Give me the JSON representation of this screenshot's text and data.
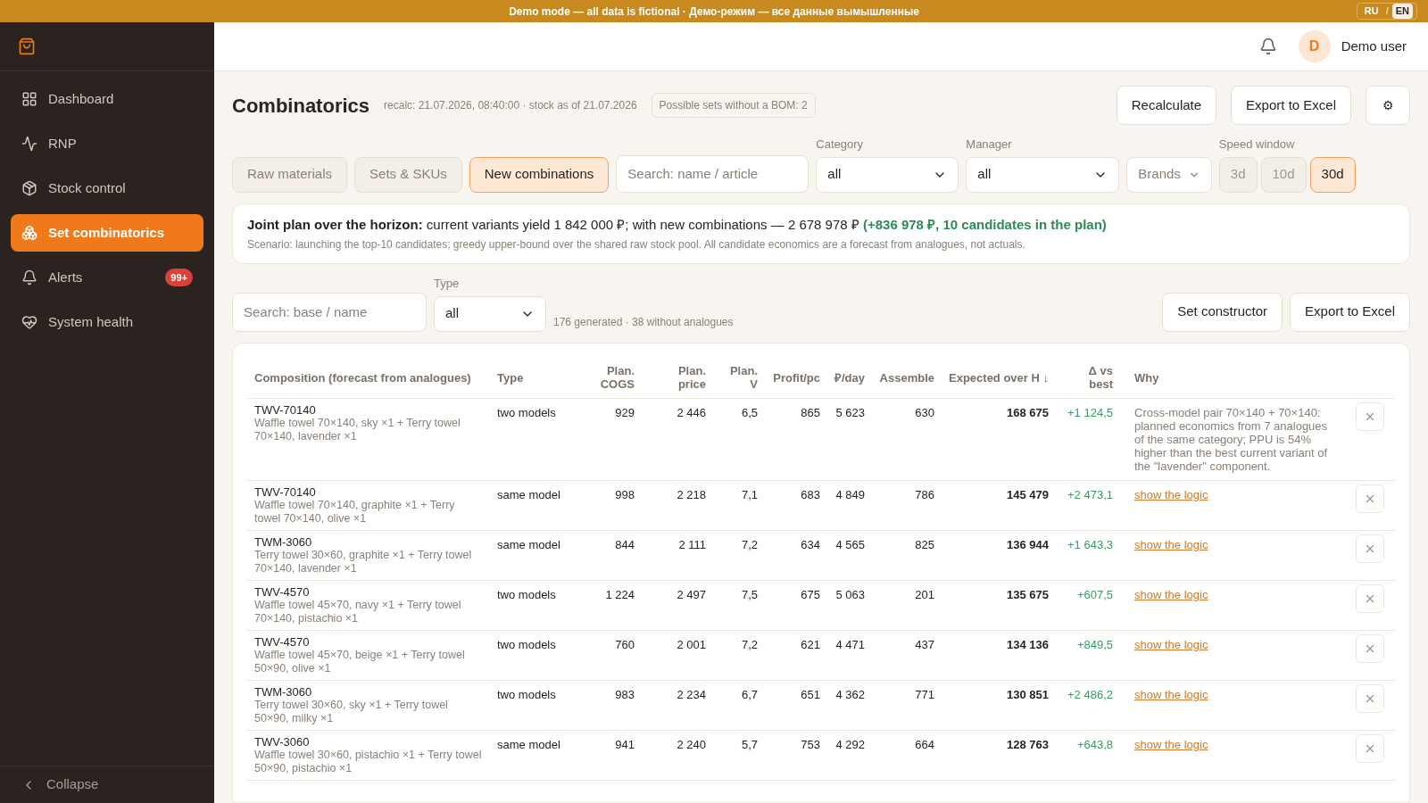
{
  "banner": {
    "text": "Demo mode — all data is fictional · Демо-режим — все данные вымышленные",
    "languages": [
      {
        "label": "RU",
        "selected": false
      },
      {
        "label": "EN",
        "selected": true
      }
    ],
    "separator": "/"
  },
  "sidebar": {
    "items": [
      {
        "label": "Dashboard",
        "selected": false
      },
      {
        "label": "RNP",
        "selected": false
      },
      {
        "label": "Stock control",
        "selected": false
      },
      {
        "label": "Set combinatorics",
        "selected": true
      },
      {
        "label": "Alerts",
        "selected": false,
        "badge": "99+"
      },
      {
        "label": "System health",
        "selected": false
      }
    ],
    "collapse": "Collapse"
  },
  "header": {
    "avatar": "D",
    "user": "Demo user"
  },
  "page": {
    "title": "Combinatorics",
    "meta": "recalc: 21.07.2026, 08:40:00 · stock as of 21.07.2026",
    "bom_chip": "Possible sets without a BOM: 2",
    "actions": [
      "Recalculate",
      "Export to Excel"
    ],
    "settings": "⚙"
  },
  "tabs": [
    {
      "label": "Raw materials",
      "selected": false
    },
    {
      "label": "Sets & SKUs",
      "selected": false
    },
    {
      "label": "New combinations",
      "selected": true
    }
  ],
  "filters": {
    "search": {
      "placeholder": "Search: name / article"
    },
    "category": {
      "label": "Category",
      "value": "all"
    },
    "manager": {
      "label": "Manager",
      "value": "all"
    },
    "brands": "Brands",
    "speed": {
      "label": "Speed window",
      "options": [
        {
          "label": "3d",
          "selected": false
        },
        {
          "label": "10d",
          "selected": false
        },
        {
          "label": "30d",
          "selected": true
        }
      ]
    }
  },
  "plan": {
    "bold": "Joint plan over the horizon:",
    "text": "current variants yield 1 842 000 ₽; with new combinations — 2 678 978 ₽",
    "gain": "(+836 978 ₽, 10 candidates in the plan)",
    "note": "Scenario: launching the top-10 candidates; greedy upper-bound over the shared raw stock pool. All candidate economics are a forecast from analogues, not actuals."
  },
  "toolbar": {
    "search": {
      "placeholder": "Search: base / name"
    },
    "type": {
      "label": "Type",
      "value": "all"
    },
    "summary": "176 generated · 38 without analogues",
    "actions": [
      "Set constructor",
      "Export to Excel"
    ]
  },
  "table": {
    "columns": [
      "Composition (forecast from analogues)",
      "Type",
      "Plan. COGS",
      "Plan. price",
      "Plan. V",
      "Profit/pc",
      "₽/day",
      "Assemble",
      "Expected over H ↓",
      "Δ vs best",
      "Why"
    ],
    "rows": [
      {
        "code": "TWV-70140",
        "desc": "Waffle towel 70×140, sky ×1 + Terry towel 70×140, lavender ×1",
        "type": "two models",
        "cogs": "929",
        "price": "2 446",
        "v": "6,5",
        "profit": "865",
        "per_day": "5 623",
        "assemble": "630",
        "expected": "168 675",
        "delta": "+1 124,5",
        "why": {
          "kind": "text",
          "text": "Cross-model pair 70×140 + 70×140: planned economics from 7 analogues of the same category; PPU is 54% higher than the best current variant of the \"lavender\" component."
        }
      },
      {
        "code": "TWV-70140",
        "desc": "Waffle towel 70×140, graphite ×1 + Terry towel 70×140, olive ×1",
        "type": "same model",
        "cogs": "998",
        "price": "2 218",
        "v": "7,1",
        "profit": "683",
        "per_day": "4 849",
        "assemble": "786",
        "expected": "145 479",
        "delta": "+2 473,1",
        "why": {
          "kind": "link",
          "text": "show the logic"
        }
      },
      {
        "code": "TWM-3060",
        "desc": "Terry towel 30×60, graphite ×1 + Terry towel 70×140, lavender ×1",
        "type": "same model",
        "cogs": "844",
        "price": "2 111",
        "v": "7,2",
        "profit": "634",
        "per_day": "4 565",
        "assemble": "825",
        "expected": "136 944",
        "delta": "+1 643,3",
        "why": {
          "kind": "link",
          "text": "show the logic"
        }
      },
      {
        "code": "TWV-4570",
        "desc": "Waffle towel 45×70, navy ×1 + Terry towel 70×140, pistachio ×1",
        "type": "two models",
        "cogs": "1 224",
        "price": "2 497",
        "v": "7,5",
        "profit": "675",
        "per_day": "5 063",
        "assemble": "201",
        "expected": "135 675",
        "delta": "+607,5",
        "why": {
          "kind": "link",
          "text": "show the logic"
        }
      },
      {
        "code": "TWV-4570",
        "desc": "Waffle towel 45×70, beige ×1 + Terry towel 50×90, olive ×1",
        "type": "two models",
        "cogs": "760",
        "price": "2 001",
        "v": "7,2",
        "profit": "621",
        "per_day": "4 471",
        "assemble": "437",
        "expected": "134 136",
        "delta": "+849,5",
        "why": {
          "kind": "link",
          "text": "show the logic"
        }
      },
      {
        "code": "TWM-3060",
        "desc": "Terry towel 30×60, sky ×1 + Terry towel 50×90, milky ×1",
        "type": "two models",
        "cogs": "983",
        "price": "2 234",
        "v": "6,7",
        "profit": "651",
        "per_day": "4 362",
        "assemble": "771",
        "expected": "130 851",
        "delta": "+2 486,2",
        "why": {
          "kind": "link",
          "text": "show the logic"
        }
      },
      {
        "code": "TWV-3060",
        "desc": "Waffle towel 30×60, pistachio ×1 + Terry towel 50×90, pistachio ×1",
        "type": "same model",
        "cogs": "941",
        "price": "2 240",
        "v": "5,7",
        "profit": "753",
        "per_day": "4 292",
        "assemble": "664",
        "expected": "128 763",
        "delta": "+643,8",
        "why": {
          "kind": "link",
          "text": "show the logic"
        }
      }
    ]
  }
}
